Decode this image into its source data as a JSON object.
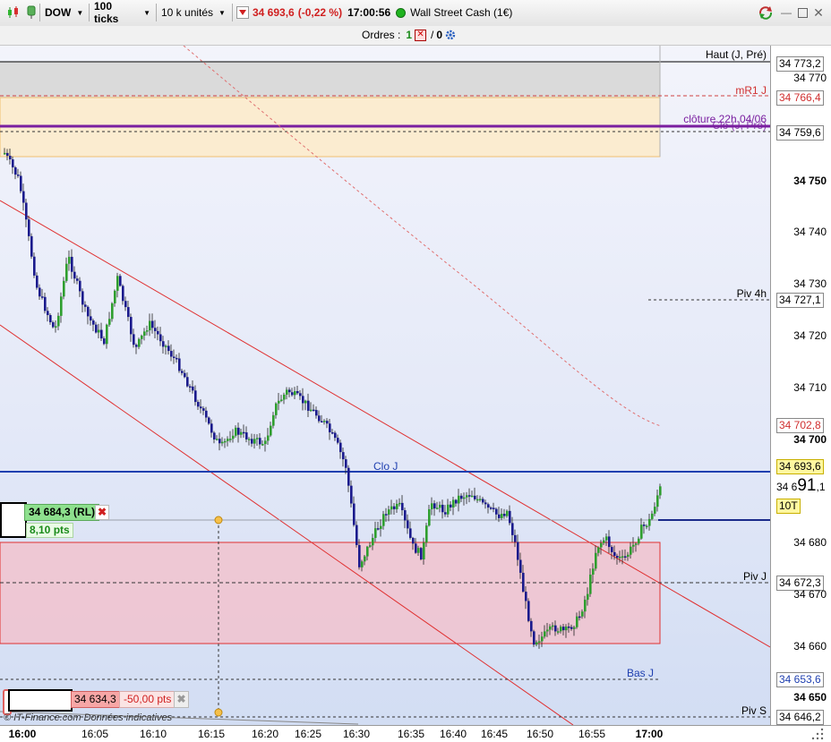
{
  "toolbar": {
    "instrument": "DOW",
    "ticks": "100 ticks",
    "units": "10 k unités",
    "last_price": "34 693,6",
    "change": "(-0,22 %)",
    "time": "17:00:56",
    "market": "Wall Street Cash (1€)"
  },
  "orders": {
    "label": "Ordres :",
    "count1": "1",
    "count2": "0"
  },
  "levels": {
    "haut": "Haut (J, Pré)",
    "mr1": "mR1 J",
    "cloture": "clôture 22h 04/06",
    "clo_pre": "Clo (J, Pré)",
    "piv4h": "Piv 4h",
    "clo_j": "Clo J",
    "piv_j": "Piv J",
    "bas_j": "Bas J",
    "piv_s": "Piv S"
  },
  "position": {
    "entry": "34 684,3 (RL)",
    "pts": "8,10 pts",
    "stop": "34 634,3",
    "stop_pts": "-50,00 pts"
  },
  "yaxis": {
    "ticks": [
      "34 770",
      "34 750",
      "34 740",
      "34 730",
      "34 720",
      "34 710",
      "34 700",
      "34 680",
      "34 670",
      "34 660",
      "34 650"
    ],
    "tags": {
      "t1": "34 773,2",
      "t2": "34 766,4",
      "t3": "34 759,6",
      "t4": "34 727,1",
      "t5": "34 702,8",
      "t6": "34 693,6",
      "t7": "34 672,3",
      "t8": "34 653,6",
      "t9": "34 646,2"
    },
    "current_prefix": "34 6",
    "current_big": "91",
    "current_suffix": ",1",
    "countdown": "10T"
  },
  "xaxis": {
    "ticks": [
      "16:00",
      "16:05",
      "16:10",
      "16:15",
      "16:20",
      "16:25",
      "16:30",
      "16:35",
      "16:40",
      "16:45",
      "16:50",
      "16:55",
      "17:00"
    ]
  },
  "footer": {
    "credit": "© IT-Finance.com Données indicatives"
  },
  "colors": {
    "up": "#2e9e2e",
    "down": "#1a1a8c",
    "cloj": "#2040b0",
    "zone": "#f1c8d2",
    "zone_border": "#e03030"
  }
}
